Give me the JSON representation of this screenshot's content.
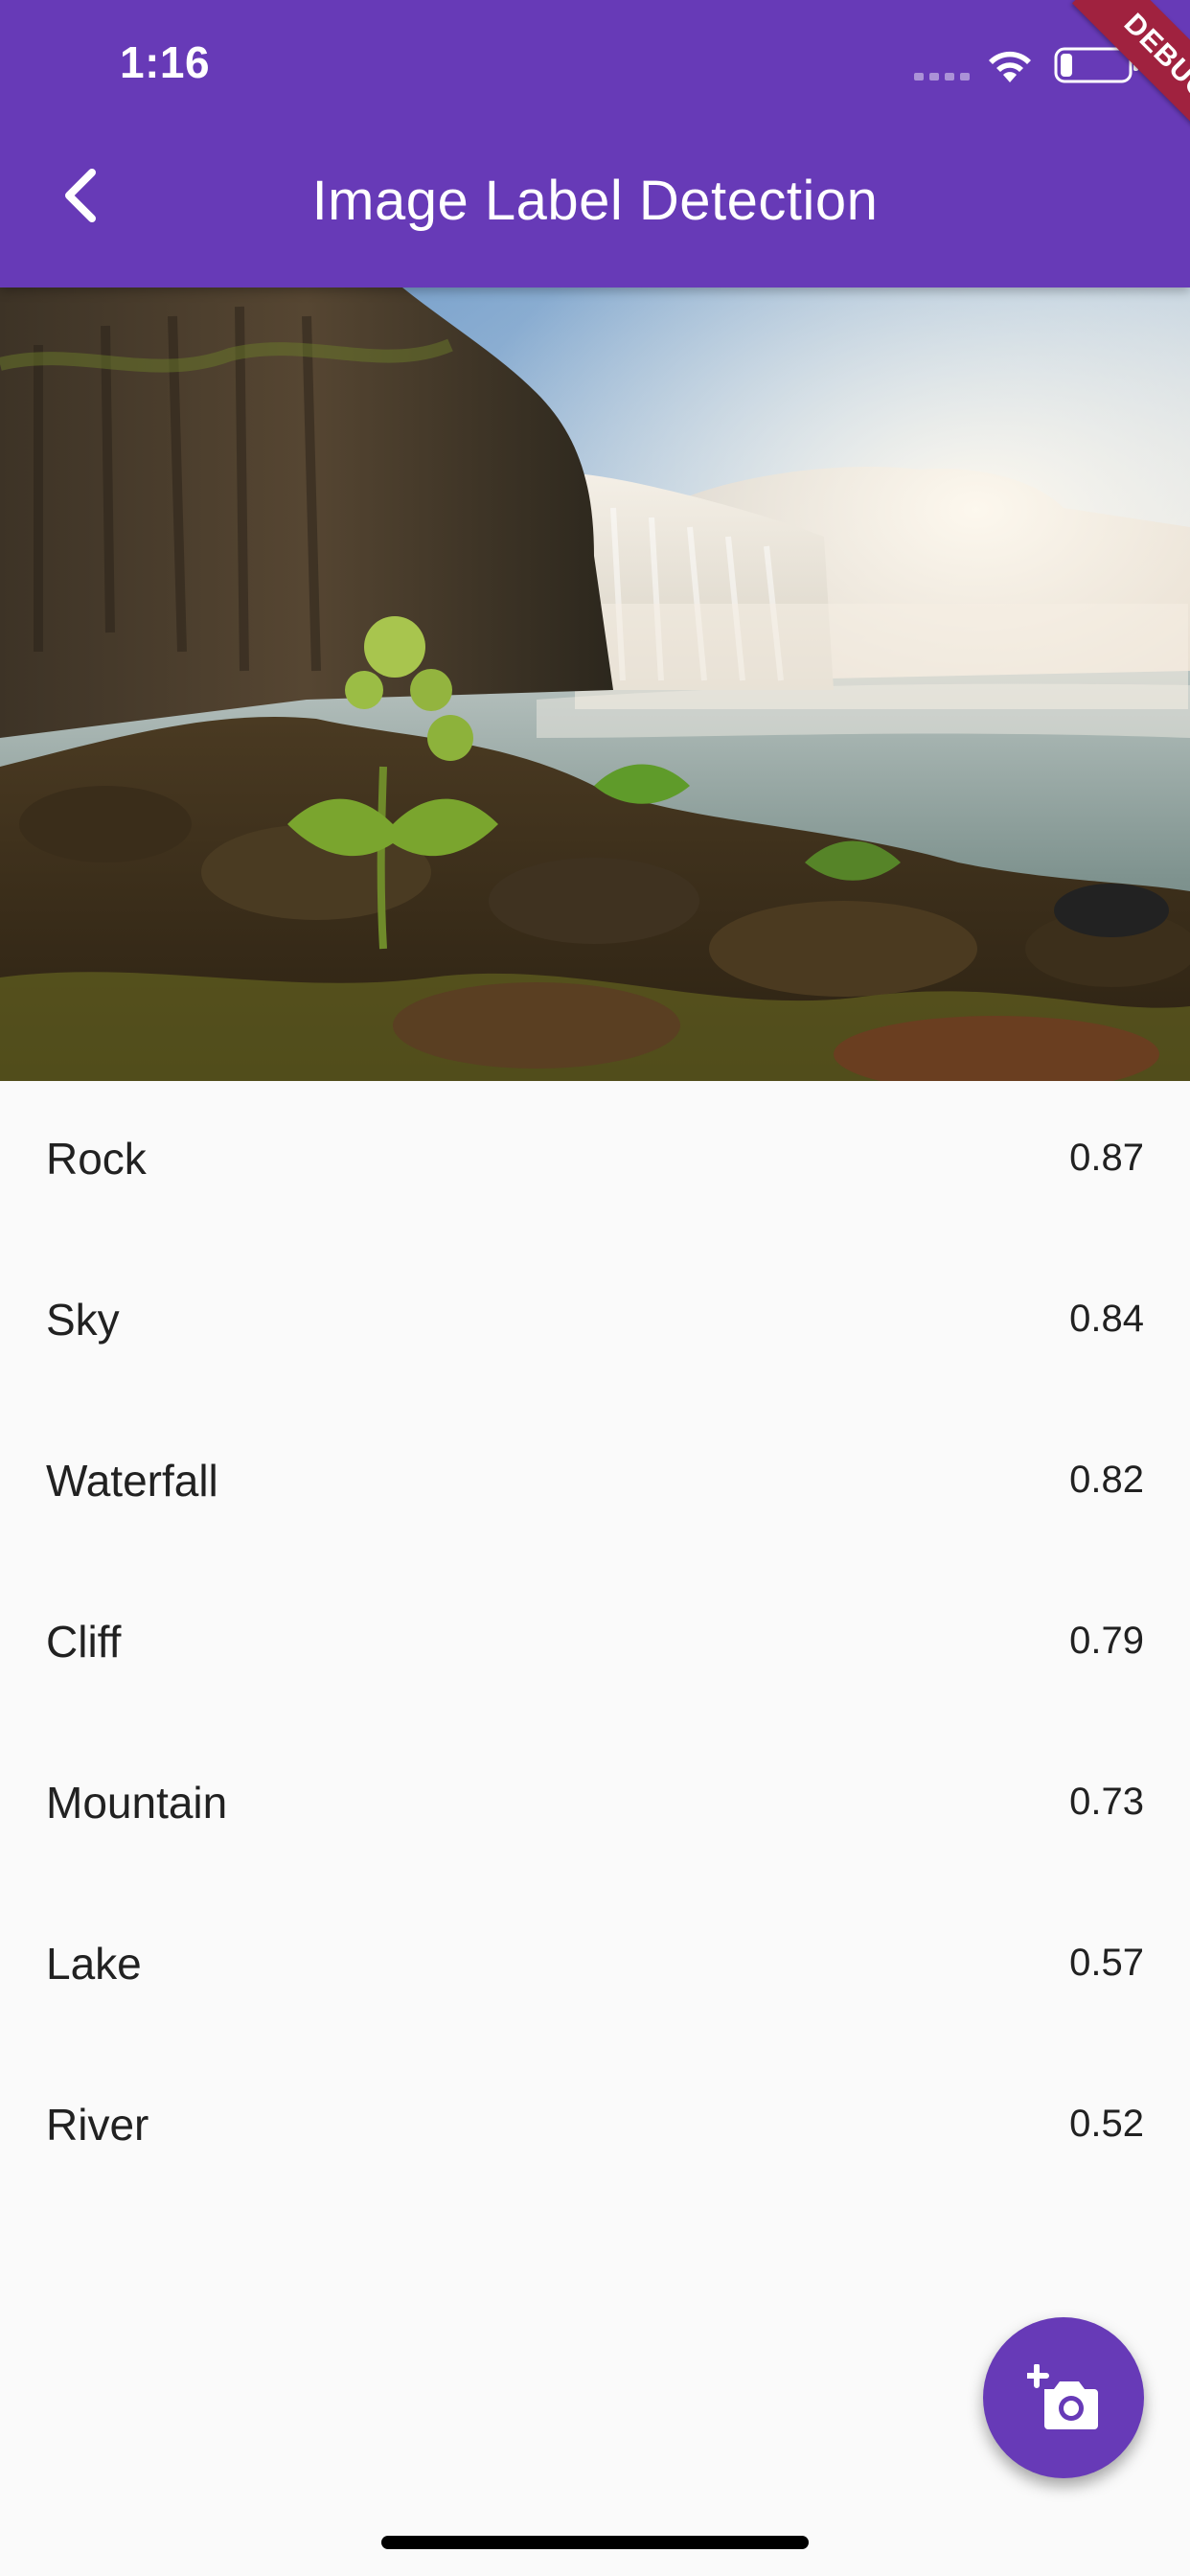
{
  "status_bar": {
    "time": "1:16"
  },
  "debug_banner": "DEBUG",
  "app_bar": {
    "title": "Image Label Detection",
    "back_icon": "chevron-left-icon"
  },
  "hero_image": {
    "subject": "waterfall landscape photo"
  },
  "labels": [
    {
      "label": "Rock",
      "score": "0.87"
    },
    {
      "label": "Sky",
      "score": "0.84"
    },
    {
      "label": "Waterfall",
      "score": "0.82"
    },
    {
      "label": "Cliff",
      "score": "0.79"
    },
    {
      "label": "Mountain",
      "score": "0.73"
    },
    {
      "label": "Lake",
      "score": "0.57"
    },
    {
      "label": "River",
      "score": "0.52"
    }
  ],
  "fab": {
    "icon": "add-photo-camera-icon"
  },
  "colors": {
    "primary": "#673ab7",
    "background": "#fafafa",
    "debug_banner": "#a0223f",
    "text": "#212121"
  }
}
